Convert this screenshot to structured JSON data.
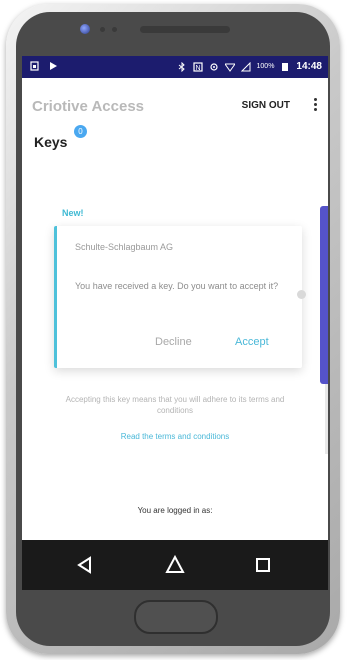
{
  "statusbar": {
    "battery": "100%",
    "time": "14:48"
  },
  "appbar": {
    "title": "Criotive Access",
    "signout_label": "SIGN OUT"
  },
  "keys": {
    "title": "Keys",
    "badge_count": "0"
  },
  "card": {
    "new_label": "New!",
    "company": "Schulte-Schlagbaum AG",
    "message": "You have received a key. Do you want to accept it?",
    "decline_label": "Decline",
    "accept_label": "Accept"
  },
  "terms": {
    "note": "Accepting this key means that you will adhere to its terms and conditions",
    "link": "Read the terms and conditions"
  },
  "session": {
    "logged_in_label": "You are logged in as:"
  },
  "colors": {
    "statusbar": "#1c1c6e",
    "accent": "#4ab8d8",
    "scrollbar": "#5553c9"
  }
}
